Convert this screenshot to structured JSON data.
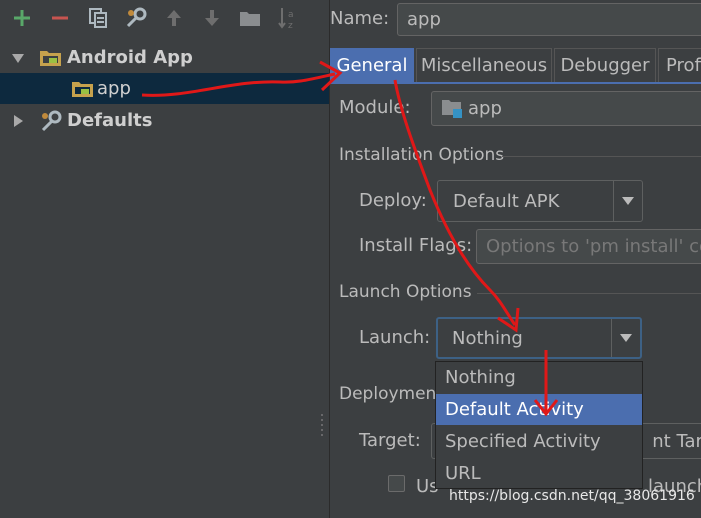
{
  "colors": {
    "background": "#3c3f41",
    "selection": "#4b6eaf",
    "tree_selection": "#0d293e",
    "annotation_red": "#e01818",
    "add_green": "#59a869",
    "remove_red": "#c75450"
  },
  "toolbar": {
    "icons": [
      "add-icon",
      "remove-icon",
      "copy-icon",
      "wrench-icon",
      "move-up-icon",
      "move-down-icon",
      "folder-icon",
      "sort-az-icon"
    ]
  },
  "tree": {
    "android_app": "Android App",
    "app": "app",
    "defaults": "Defaults"
  },
  "form": {
    "name_label": "Name:",
    "name_value": "app",
    "tabs": [
      "General",
      "Miscellaneous",
      "Debugger",
      "Profi"
    ],
    "module_label": "Module:",
    "module_value": "app",
    "installation_section": "Installation Options",
    "deploy_label": "Deploy:",
    "deploy_value": "Default APK",
    "install_flags_label": "Install Flags:",
    "install_flags_placeholder": "Options to 'pm install' co",
    "launch_section": "Launch Options",
    "launch_label": "Launch:",
    "launch_value": "Nothing",
    "deployment_section": "Deployment",
    "target_label": "Target:",
    "target_value_partial": "nt Targ",
    "checkbox_label_partial_left": "Us",
    "checkbox_label_partial_right": "launch"
  },
  "dropdown": {
    "options": [
      "Nothing",
      "Default Activity",
      "Specified Activity",
      "URL"
    ],
    "selected": "Default Activity"
  },
  "watermark": "https://blog.csdn.net/qq_38061916"
}
